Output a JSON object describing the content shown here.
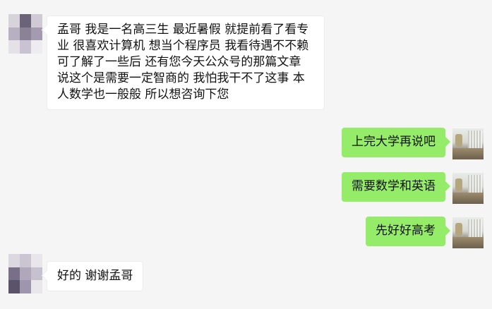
{
  "conversation": {
    "messages": [
      {
        "side": "left",
        "text": "孟哥  我是一名高三生  最近暑假 就提前看了看专业  很喜欢计算机 想当个程序员 我看待遇不不赖   可了解了一些后 还有您今天公众号的那篇文章 说这个是需要一定智商的  我怕我干不了这事 本人数学也一般般   所以想咨询下您",
        "avatar_icon": "pixelated-avatar-icon"
      },
      {
        "side": "right",
        "text": "上完大学再说吧",
        "avatar_icon": "desk-photo-avatar-icon"
      },
      {
        "side": "right",
        "text": "需要数学和英语",
        "avatar_icon": "desk-photo-avatar-icon"
      },
      {
        "side": "right",
        "text": "先好好高考",
        "avatar_icon": "desk-photo-avatar-icon"
      },
      {
        "side": "left",
        "text": "好的 谢谢孟哥",
        "avatar_icon": "pixelated-avatar-icon"
      }
    ]
  },
  "colors": {
    "background": "#f5f5f5",
    "left_bubble": "#ffffff",
    "right_bubble": "#95ec69",
    "text": "#111111"
  }
}
